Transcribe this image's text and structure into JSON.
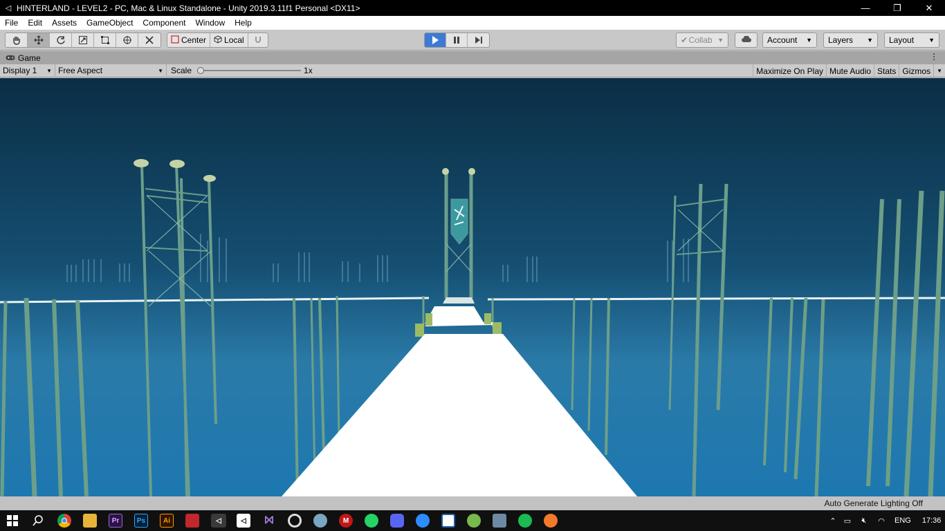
{
  "window": {
    "title": "HINTERLAND - LEVEL2 - PC, Mac & Linux Standalone - Unity 2019.3.11f1 Personal <DX11>"
  },
  "menu": [
    "File",
    "Edit",
    "Assets",
    "GameObject",
    "Component",
    "Window",
    "Help"
  ],
  "toolbar": {
    "tools": [
      "hand-tool-icon",
      "move-tool-icon",
      "rotate-tool-icon",
      "scale-tool-icon",
      "rect-tool-icon",
      "transform-tool-icon",
      "custom-tool-icon"
    ],
    "center_label": "Center",
    "local_label": "Local",
    "collab_label": "Collab",
    "account_label": "Account",
    "layers_label": "Layers",
    "layout_label": "Layout"
  },
  "game_tab": {
    "label": "Game"
  },
  "game_bar": {
    "display": "Display 1",
    "aspect": "Free Aspect",
    "scale_label": "Scale",
    "scale_value": "1x",
    "maximize": "Maximize On Play",
    "mute": "Mute Audio",
    "stats": "Stats",
    "gizmos": "Gizmos"
  },
  "status": {
    "text": "Auto Generate Lighting Off"
  },
  "taskbar": {
    "apps": [
      "chrome-icon",
      "explorer-icon",
      "premiere-icon",
      "photoshop-icon",
      "illustrator-icon",
      "powershell-icon",
      "unity-icon",
      "unity-hub-icon",
      "visual-studio-icon",
      "cortana-icon",
      "paint-icon",
      "mcafee-icon",
      "whatsapp-icon",
      "discord-icon",
      "zoom-icon",
      "news-icon",
      "utorrent-icon",
      "photos-icon",
      "spotify-icon",
      "blender-icon"
    ],
    "app_glyphs": {
      "premiere": "Pr",
      "photoshop": "Ps",
      "illustrator": "Ai"
    },
    "language": "ENG",
    "time": "17:36"
  },
  "colors": {
    "play_active": "#3d7ad6",
    "sky_top": "#0b2e45",
    "sky_horizon": "#2a7aa8",
    "water": "#1d78b0",
    "pole": "#6b9e8c"
  }
}
